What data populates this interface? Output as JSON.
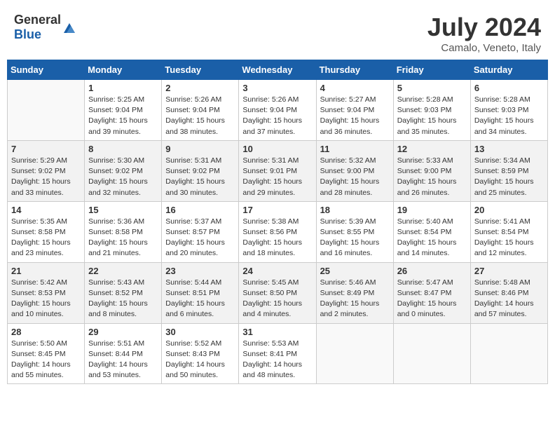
{
  "header": {
    "logo_general": "General",
    "logo_blue": "Blue",
    "month_title": "July 2024",
    "subtitle": "Camalo, Veneto, Italy"
  },
  "weekdays": [
    "Sunday",
    "Monday",
    "Tuesday",
    "Wednesday",
    "Thursday",
    "Friday",
    "Saturday"
  ],
  "weeks": [
    [
      {
        "day": "",
        "info": ""
      },
      {
        "day": "1",
        "info": "Sunrise: 5:25 AM\nSunset: 9:04 PM\nDaylight: 15 hours\nand 39 minutes."
      },
      {
        "day": "2",
        "info": "Sunrise: 5:26 AM\nSunset: 9:04 PM\nDaylight: 15 hours\nand 38 minutes."
      },
      {
        "day": "3",
        "info": "Sunrise: 5:26 AM\nSunset: 9:04 PM\nDaylight: 15 hours\nand 37 minutes."
      },
      {
        "day": "4",
        "info": "Sunrise: 5:27 AM\nSunset: 9:04 PM\nDaylight: 15 hours\nand 36 minutes."
      },
      {
        "day": "5",
        "info": "Sunrise: 5:28 AM\nSunset: 9:03 PM\nDaylight: 15 hours\nand 35 minutes."
      },
      {
        "day": "6",
        "info": "Sunrise: 5:28 AM\nSunset: 9:03 PM\nDaylight: 15 hours\nand 34 minutes."
      }
    ],
    [
      {
        "day": "7",
        "info": "Sunrise: 5:29 AM\nSunset: 9:02 PM\nDaylight: 15 hours\nand 33 minutes."
      },
      {
        "day": "8",
        "info": "Sunrise: 5:30 AM\nSunset: 9:02 PM\nDaylight: 15 hours\nand 32 minutes."
      },
      {
        "day": "9",
        "info": "Sunrise: 5:31 AM\nSunset: 9:02 PM\nDaylight: 15 hours\nand 30 minutes."
      },
      {
        "day": "10",
        "info": "Sunrise: 5:31 AM\nSunset: 9:01 PM\nDaylight: 15 hours\nand 29 minutes."
      },
      {
        "day": "11",
        "info": "Sunrise: 5:32 AM\nSunset: 9:00 PM\nDaylight: 15 hours\nand 28 minutes."
      },
      {
        "day": "12",
        "info": "Sunrise: 5:33 AM\nSunset: 9:00 PM\nDaylight: 15 hours\nand 26 minutes."
      },
      {
        "day": "13",
        "info": "Sunrise: 5:34 AM\nSunset: 8:59 PM\nDaylight: 15 hours\nand 25 minutes."
      }
    ],
    [
      {
        "day": "14",
        "info": "Sunrise: 5:35 AM\nSunset: 8:58 PM\nDaylight: 15 hours\nand 23 minutes."
      },
      {
        "day": "15",
        "info": "Sunrise: 5:36 AM\nSunset: 8:58 PM\nDaylight: 15 hours\nand 21 minutes."
      },
      {
        "day": "16",
        "info": "Sunrise: 5:37 AM\nSunset: 8:57 PM\nDaylight: 15 hours\nand 20 minutes."
      },
      {
        "day": "17",
        "info": "Sunrise: 5:38 AM\nSunset: 8:56 PM\nDaylight: 15 hours\nand 18 minutes."
      },
      {
        "day": "18",
        "info": "Sunrise: 5:39 AM\nSunset: 8:55 PM\nDaylight: 15 hours\nand 16 minutes."
      },
      {
        "day": "19",
        "info": "Sunrise: 5:40 AM\nSunset: 8:54 PM\nDaylight: 15 hours\nand 14 minutes."
      },
      {
        "day": "20",
        "info": "Sunrise: 5:41 AM\nSunset: 8:54 PM\nDaylight: 15 hours\nand 12 minutes."
      }
    ],
    [
      {
        "day": "21",
        "info": "Sunrise: 5:42 AM\nSunset: 8:53 PM\nDaylight: 15 hours\nand 10 minutes."
      },
      {
        "day": "22",
        "info": "Sunrise: 5:43 AM\nSunset: 8:52 PM\nDaylight: 15 hours\nand 8 minutes."
      },
      {
        "day": "23",
        "info": "Sunrise: 5:44 AM\nSunset: 8:51 PM\nDaylight: 15 hours\nand 6 minutes."
      },
      {
        "day": "24",
        "info": "Sunrise: 5:45 AM\nSunset: 8:50 PM\nDaylight: 15 hours\nand 4 minutes."
      },
      {
        "day": "25",
        "info": "Sunrise: 5:46 AM\nSunset: 8:49 PM\nDaylight: 15 hours\nand 2 minutes."
      },
      {
        "day": "26",
        "info": "Sunrise: 5:47 AM\nSunset: 8:47 PM\nDaylight: 15 hours\nand 0 minutes."
      },
      {
        "day": "27",
        "info": "Sunrise: 5:48 AM\nSunset: 8:46 PM\nDaylight: 14 hours\nand 57 minutes."
      }
    ],
    [
      {
        "day": "28",
        "info": "Sunrise: 5:50 AM\nSunset: 8:45 PM\nDaylight: 14 hours\nand 55 minutes."
      },
      {
        "day": "29",
        "info": "Sunrise: 5:51 AM\nSunset: 8:44 PM\nDaylight: 14 hours\nand 53 minutes."
      },
      {
        "day": "30",
        "info": "Sunrise: 5:52 AM\nSunset: 8:43 PM\nDaylight: 14 hours\nand 50 minutes."
      },
      {
        "day": "31",
        "info": "Sunrise: 5:53 AM\nSunset: 8:41 PM\nDaylight: 14 hours\nand 48 minutes."
      },
      {
        "day": "",
        "info": ""
      },
      {
        "day": "",
        "info": ""
      },
      {
        "day": "",
        "info": ""
      }
    ]
  ]
}
